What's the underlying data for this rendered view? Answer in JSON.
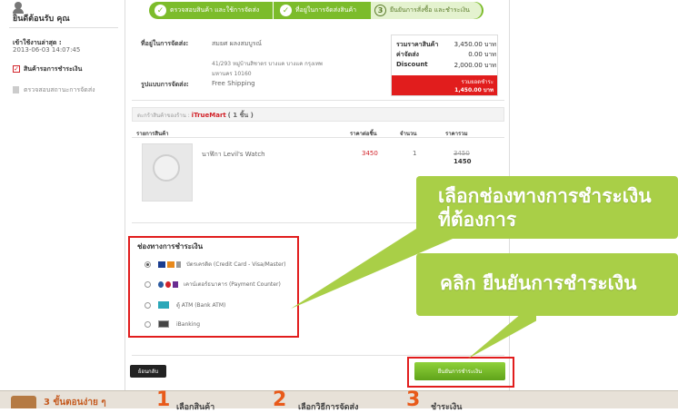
{
  "sidebar": {
    "greeting": "ยินดีต้อนรับ คุณ",
    "last_login_label": "เข้าใช้งานล่าสุด :",
    "last_login_date": "2013-06-03 14:07:45",
    "items": [
      {
        "label": "สินค้ารอการชำระเงิน",
        "active": true
      },
      {
        "label": "ตรวจสอบสถานะการจัดส่ง",
        "active": false
      }
    ]
  },
  "steps": [
    {
      "label": "ตรวจสอบสินค้า และใช้การจัดส่ง",
      "icon": "check-icon"
    },
    {
      "label": "ที่อยู่ในการจัดส่งสินค้า",
      "icon": "check-icon"
    },
    {
      "number": "3",
      "label": "ยืนยันการสั่งซื้อ และชำระเงิน"
    }
  ],
  "address": {
    "label": "ที่อยู่ในการจัดส่ง:",
    "name": "สมยศ ผลงสมบูรณ์",
    "line1": "41/293 หมู่บ้านสิชาตร บางแค บางแค กรุงเทพ",
    "line2": "มหานคร 10160"
  },
  "shipping": {
    "label": "รูปแบบการจัดส่ง:",
    "value": "Free Shipping"
  },
  "summary": {
    "rows": [
      {
        "label": "รวมราคาสินค้า",
        "value": "3,450.00 บาท"
      },
      {
        "label": "ค่าจัดส่ง",
        "value": "0.00 บาท"
      },
      {
        "label": "Discount",
        "value": "2,000.00 บาท"
      }
    ],
    "total_label": "รวมยอดชำระ",
    "total_value": "1,450.00 บาท"
  },
  "store": {
    "prefix": "ตะกร้าสินค้าของร้าน :",
    "name": "iTrueMart",
    "count": "( 1 ชิ้น )"
  },
  "table": {
    "headers": [
      "รายการสินค้า",
      "ราคาต่อชิ้น",
      "จำนวน",
      "ราคารวม"
    ],
    "rows": [
      {
        "product": "นาฬิกา Levil's Watch",
        "price": "3450",
        "qty": "1",
        "total_old": "3450",
        "total": "1450"
      }
    ]
  },
  "payment": {
    "title": "ช่องทางการชำระเงิน",
    "options": [
      {
        "label": "บัตรเครดิต (Credit Card - Visa/Master)",
        "selected": true
      },
      {
        "label": "เคาน์เตอร์ธนาคาร (Payment Counter)",
        "selected": false
      },
      {
        "label": "ตู้ ATM (Bank ATM)",
        "selected": false
      },
      {
        "label": "iBanking",
        "selected": false
      }
    ]
  },
  "buttons": {
    "back": "ย้อนกลับ",
    "confirm": "ยืนยันการชำระเงิน"
  },
  "callouts": {
    "select_line1": "เลือกช่องทางการชำระเงิน",
    "select_line2": "ที่ต้องการ",
    "click": "คลิก  ยืนยันการชำระเงิน"
  },
  "banner": {
    "title": "3 ขั้นตอนง่าย ๆ",
    "step1_num": "1",
    "step1": "เลือกสินค้า",
    "step2_num": "2",
    "step2": "เลือกวิธีการจัดส่ง",
    "step3_num": "3",
    "step3": "ชำระเงิน"
  },
  "colors": {
    "accent_green": "#7cbc2b",
    "callout_green": "#a9cf47",
    "highlight_red": "#e11d1d"
  }
}
